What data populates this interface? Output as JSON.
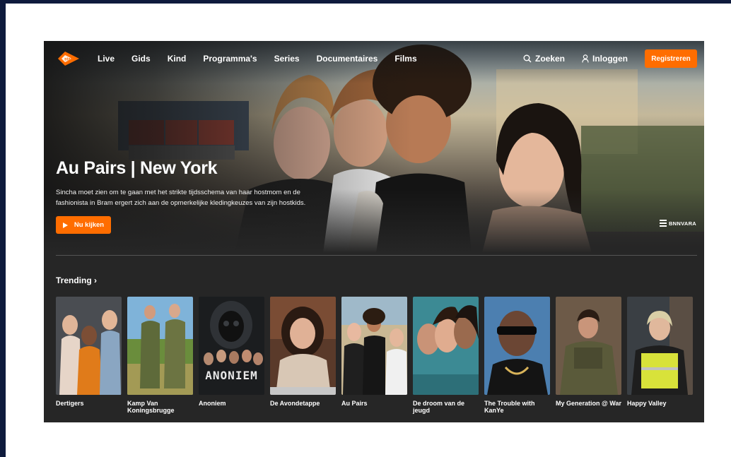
{
  "brand": {
    "logo_text": "start",
    "accent": "#ff6d00"
  },
  "nav": {
    "items": [
      "Live",
      "Gids",
      "Kind",
      "Programma's",
      "Series",
      "Documentaires",
      "Films"
    ],
    "search_label": "Zoeken",
    "login_label": "Inloggen",
    "register_label": "Registreren"
  },
  "hero": {
    "title": "Au Pairs | New York",
    "description": "Sincha moet zien om te gaan met het strikte tijdsschema van haar hostmom en de fashionista in Bram ergert zich aan de opmerkelijke kledingkeuzes van zijn hostkids.",
    "watch_label": "Nu kijken",
    "broadcaster": "BNNVARA"
  },
  "trending": {
    "title": "Trending ›",
    "items": [
      {
        "title": "Dertigers"
      },
      {
        "title": "Kamp Van Koningsbrugge"
      },
      {
        "title": "Anoniem",
        "poster_text": "ANONIEM"
      },
      {
        "title": "De Avondetappe"
      },
      {
        "title": "Au Pairs"
      },
      {
        "title": "De droom van de jeugd"
      },
      {
        "title": "The Trouble with KanYe"
      },
      {
        "title": "My Generation @ War"
      },
      {
        "title": "Happy Valley"
      }
    ]
  }
}
